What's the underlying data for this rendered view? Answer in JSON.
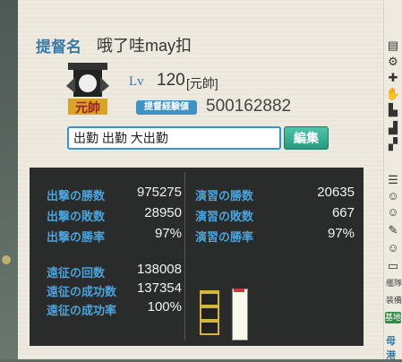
{
  "header": {
    "title_label": "提督名",
    "admiral_name": "哦了哇may扣"
  },
  "level": {
    "label": "Lv",
    "value": "120",
    "rank": "[元帥]"
  },
  "experience": {
    "label": "提督経験値",
    "value": "500162882"
  },
  "comment": {
    "value": "出勤 出勤 大出勤"
  },
  "edit_button": {
    "label": "編集"
  },
  "stats": {
    "sortie": [
      {
        "label": "出撃の勝数",
        "value": "975275"
      },
      {
        "label": "出撃の敗数",
        "value": "28950"
      },
      {
        "label": "出撃の勝率",
        "value": "97%"
      }
    ],
    "exercise": [
      {
        "label": "演習の勝数",
        "value": "20635"
      },
      {
        "label": "演習の敗数",
        "value": "667"
      },
      {
        "label": "演習の勝率",
        "value": "97%"
      }
    ],
    "expedition": [
      {
        "label": "遠征の回数",
        "value": "138008"
      },
      {
        "label": "遠征の成功数",
        "value": "137354"
      },
      {
        "label": "遠征の成功率",
        "value": "100%"
      }
    ]
  },
  "sidebar": {
    "icons": [
      "book-icon",
      "gear-icon",
      "medical-icon",
      "hand-icon",
      "boot-icon",
      "chart-icon",
      "tool-icon",
      "fleet-icon",
      "girl-icon",
      "girl-icon",
      "girl-icon",
      "feather-icon",
      "card-icon"
    ],
    "text_1": "艦隊",
    "text_2": "装備",
    "text_3": "基地",
    "text_4": "母港"
  },
  "colors": {
    "accent": "#3a7aa8",
    "badge": "#3f93c4",
    "edit_button": "#2a9a80",
    "stats_bg": "#2a2c2b",
    "stats_label": "#4aa3dc"
  }
}
